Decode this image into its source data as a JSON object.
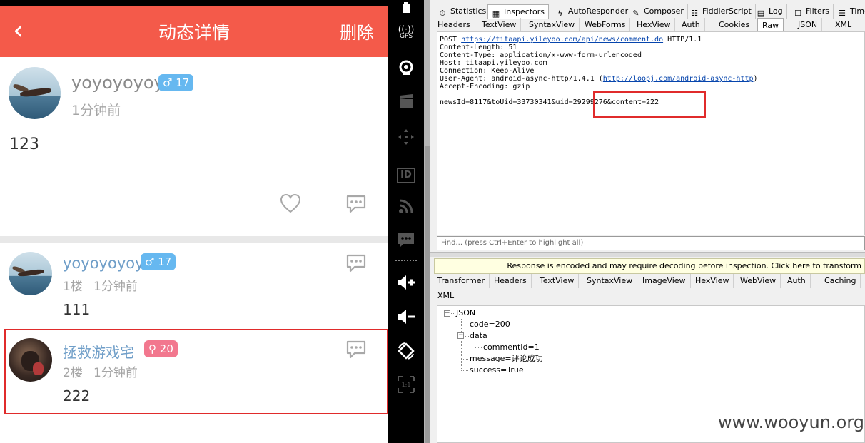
{
  "app": {
    "title": "动态详情",
    "back_glyph": "‹",
    "delete_label": "删除",
    "accent": "#f45a4a"
  },
  "post": {
    "username": "yoyoyoyoy",
    "gender_symbol": "♂",
    "level": "17",
    "time": "1分钟前",
    "content": "123",
    "like_icon": "heart-icon",
    "comment_icon": "comment-bubble-icon"
  },
  "comments": [
    {
      "username": "yoyoyoyoy",
      "gender_symbol": "♂",
      "level": "17",
      "floor": "1楼",
      "time": "1分钟前",
      "content": "111"
    },
    {
      "username": "拯救游戏宅",
      "gender_symbol": "♀",
      "level": "20",
      "floor": "2楼",
      "time": "1分钟前",
      "content": "222"
    }
  ],
  "emulator_toolbar": {
    "gps_label": "GPS",
    "id_label": "ID",
    "ratio_label": "1:1"
  },
  "fiddler": {
    "main_tabs": [
      "Statistics",
      "Inspectors",
      "AutoResponder",
      "Composer",
      "FiddlerScript",
      "Log",
      "Filters",
      "Timeline"
    ],
    "active_main_tab": "Inspectors",
    "request_tabs": [
      "Headers",
      "TextView",
      "SyntaxView",
      "WebForms",
      "HexView",
      "Auth",
      "Cookies",
      "Raw",
      "JSON",
      "XML"
    ],
    "active_request_tab": "Raw",
    "request": {
      "method": "POST",
      "url": "https://titaapi.yileyoo.com/api/news/comment.do",
      "protocol": "HTTP/1.1",
      "headers": [
        "Content-Length: 51",
        "Content-Type: application/x-www-form-urlencoded",
        "Host: titaapi.yileyoo.com",
        "Connection: Keep-Alive"
      ],
      "user_agent_prefix": "User-Agent: android-async-http/1.4.1 (",
      "user_agent_link": "http://loopj.com/android-async-http",
      "user_agent_suffix": ")",
      "accept_encoding": "Accept-Encoding: gzip",
      "body_prefix": "newsId=8117&toUid=33730341&uid=",
      "body_highlight": "29299276&content=222"
    },
    "find_placeholder": "Find... (press Ctrl+Enter to highlight all)",
    "response_notice": "Response is encoded and may require decoding before inspection. Click here to transform",
    "response_tabs": [
      "Transformer",
      "Headers",
      "TextView",
      "SyntaxView",
      "ImageView",
      "HexView",
      "WebView",
      "Auth",
      "Caching"
    ],
    "response_tabs_row2": [
      "XML"
    ],
    "json_tree": {
      "root": "JSON",
      "code": "code=200",
      "data": "data",
      "comment_id": "commentId=1",
      "message": "message=评论成功",
      "success": "success=True"
    }
  },
  "watermark": "www.wooyun.org"
}
